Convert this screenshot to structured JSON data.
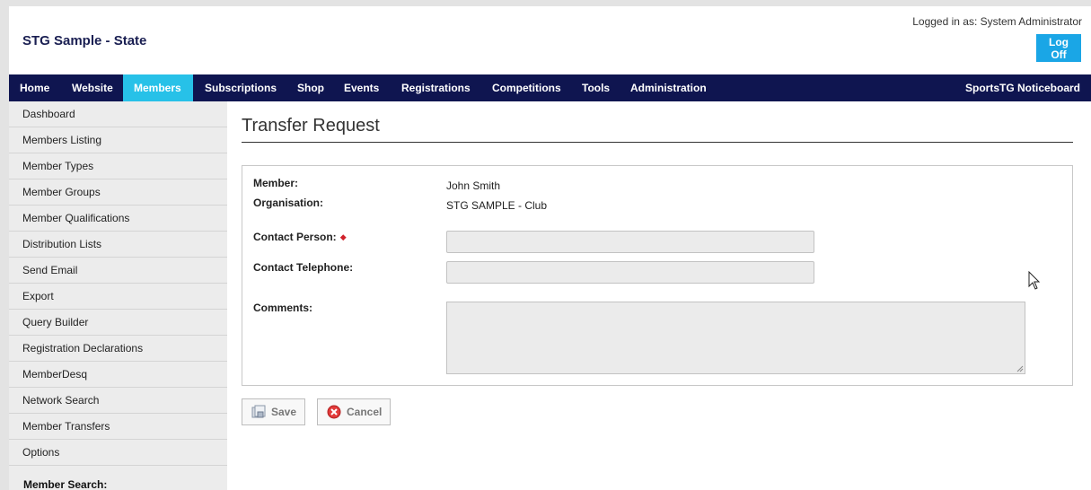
{
  "header": {
    "app_title": "STG Sample - State",
    "logged_in_text": "Logged in as: System Administrator",
    "logoff_label": "Log Off"
  },
  "topnav": {
    "items": [
      {
        "label": "Home"
      },
      {
        "label": "Website"
      },
      {
        "label": "Members",
        "active": true
      },
      {
        "label": "Subscriptions"
      },
      {
        "label": "Shop"
      },
      {
        "label": "Events"
      },
      {
        "label": "Registrations"
      },
      {
        "label": "Competitions"
      },
      {
        "label": "Tools"
      },
      {
        "label": "Administration"
      }
    ],
    "noticeboard_label": "SportsTG Noticeboard"
  },
  "sidebar": {
    "items": [
      {
        "label": "Dashboard"
      },
      {
        "label": "Members Listing"
      },
      {
        "label": "Member Types"
      },
      {
        "label": "Member Groups"
      },
      {
        "label": "Member Qualifications"
      },
      {
        "label": "Distribution Lists"
      },
      {
        "label": "Send Email"
      },
      {
        "label": "Export"
      },
      {
        "label": "Query Builder"
      },
      {
        "label": "Registration Declarations"
      },
      {
        "label": "MemberDesq"
      },
      {
        "label": "Network Search"
      },
      {
        "label": "Member Transfers"
      },
      {
        "label": "Options"
      }
    ],
    "search_label": "Member Search:"
  },
  "main": {
    "title": "Transfer Request",
    "form": {
      "member_label": "Member:",
      "member_value": "John Smith",
      "organisation_label": "Organisation:",
      "organisation_value": "STG SAMPLE - Club",
      "contact_person_label": "Contact Person:",
      "contact_person_value": "",
      "contact_telephone_label": "Contact Telephone:",
      "contact_telephone_value": "",
      "comments_label": "Comments:",
      "comments_value": ""
    },
    "buttons": {
      "save_label": "Save",
      "cancel_label": "Cancel"
    }
  },
  "colors": {
    "nav_bg": "#0f1550",
    "nav_active": "#27c1e8",
    "logoff_bg": "#1aa6e6",
    "sidebar_bg": "#ececec",
    "required": "#d0202a"
  }
}
